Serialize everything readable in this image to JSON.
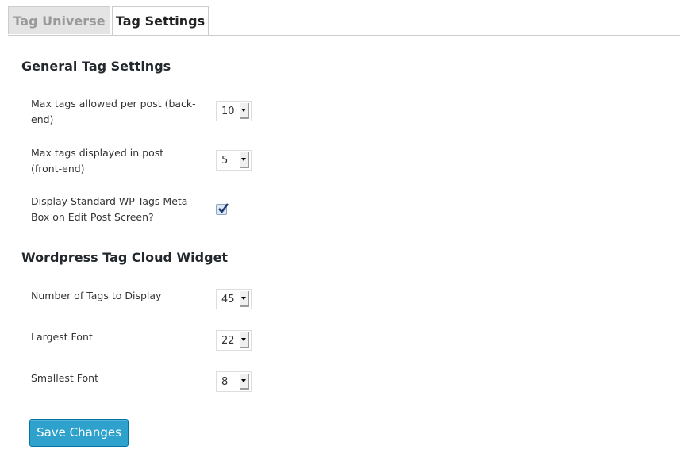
{
  "tabs": [
    {
      "label": "Tag Universe",
      "active": false
    },
    {
      "label": "Tag Settings",
      "active": true
    }
  ],
  "sections": {
    "general": {
      "title": "General Tag Settings",
      "max_tags_backend": {
        "label": "Max tags allowed per post (back-end)",
        "value": "10"
      },
      "max_tags_frontend": {
        "label": "Max tags displayed in post (front-end)",
        "value": "5"
      },
      "display_meta_box": {
        "label": "Display Standard WP Tags Meta Box on Edit Post Screen?",
        "checked": true
      }
    },
    "cloud": {
      "title": "Wordpress Tag Cloud Widget",
      "num_tags": {
        "label": "Number of Tags to Display",
        "value": "45"
      },
      "largest_font": {
        "label": "Largest Font",
        "value": "22"
      },
      "smallest_font": {
        "label": "Smallest Font",
        "value": "8"
      }
    }
  },
  "save_button": {
    "label": "Save Changes"
  },
  "colors": {
    "accent": "#2ea2cc",
    "accent_border": "#0074a2"
  }
}
